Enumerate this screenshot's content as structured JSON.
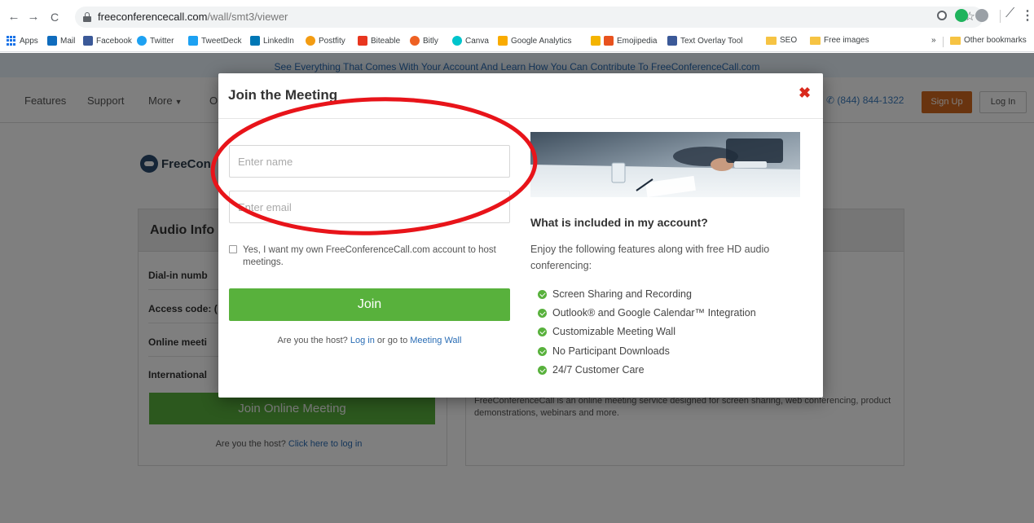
{
  "browser": {
    "back_icon": "←",
    "forward_icon": "→",
    "reload_icon": "C",
    "url_host": "freeconferencecall.com",
    "url_path": "/wall/smt3/viewer",
    "star_icon": "☆",
    "menu_icon": "⋮",
    "split_icon": "⟋",
    "bookmarks": [
      "Apps",
      "Mail",
      "Facebook",
      "Twitter",
      "TweetDeck",
      "LinkedIn",
      "Postfity",
      "Biteable",
      "Bitly",
      "Canva",
      "Google Analytics",
      "Emojipedia",
      "Text Overlay Tool",
      "SEO",
      "Free images"
    ],
    "bookmarks_overflow": "»",
    "other_bookmarks": "Other bookmarks"
  },
  "page": {
    "announcement": "See Everything That Comes With Your Account And Learn How You Can Contribute To FreeConferenceCall.com",
    "nav": {
      "features": "Features",
      "support": "Support",
      "more": "More",
      "more_chevron": "▼",
      "partial": "O",
      "phone": "(844) 844-1322",
      "phone_icon": "✆",
      "signup": "Sign Up",
      "login": "Log In"
    },
    "brand_text": "FreeCon",
    "audio_info": {
      "title": "Audio Info",
      "dial_in": "Dial-in numb",
      "access_code": "Access code: (",
      "online_meeting": "Online meeti",
      "international": "International",
      "join_online": "Join Online Meeting",
      "host_prefix": "Are you the host?",
      "host_link": "Click here to log in"
    },
    "description": "FreeConferenceCall is an online meeting service designed for screen sharing, web conferencing, product demonstrations, webinars and more."
  },
  "modal": {
    "title": "Join the Meeting",
    "close_icon": "✖",
    "name_placeholder": "Enter name",
    "email_placeholder": "Enter email",
    "checkbox_label": "Yes, I want my own FreeConferenceCall.com account to host meetings.",
    "join_label": "Join",
    "host_prefix": "Are you the host?",
    "login_link": "Log in",
    "host_middle": "or go to",
    "wall_link": "Meeting Wall",
    "included_title": "What is included in my account?",
    "included_desc": "Enjoy the following features along with free HD audio conferencing:",
    "features": [
      "Screen Sharing and Recording",
      "Outlook® and Google Calendar™ Integration",
      "Customizable Meeting Wall",
      "No Participant Downloads",
      "24/7 Customer Care"
    ]
  },
  "colors": {
    "join_green": "#58b13c",
    "close_red": "#d9291c",
    "annotation_red": "#e8141a",
    "signup_orange": "#d2691e",
    "link_blue": "#2a6db5"
  }
}
